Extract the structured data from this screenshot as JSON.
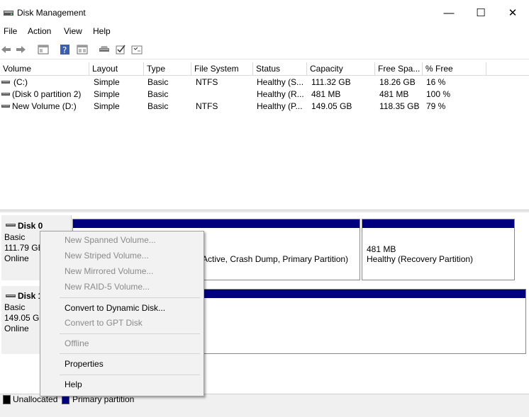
{
  "window": {
    "title": "Disk Management",
    "icon": "disk-management-icon",
    "minimize_glyph": "—",
    "maximize_glyph": "☐",
    "close_glyph": "✕"
  },
  "menu": [
    "File",
    "Action",
    "View",
    "Help"
  ],
  "toolbar": [
    "back-arrow-icon",
    "forward-arrow-icon",
    "console-tree-icon",
    "help-icon",
    "properties-icon",
    "disk-icon",
    "check-icon",
    "list-icon"
  ],
  "columns": [
    "Volume",
    "Layout",
    "Type",
    "File System",
    "Status",
    "Capacity",
    "Free Spa...",
    "% Free"
  ],
  "volumes": [
    [
      "(C:)",
      "Simple",
      "Basic",
      "NTFS",
      "Healthy (S...",
      "111.32 GB",
      "18.26 GB",
      "16 %"
    ],
    [
      "(Disk 0 partition 2)",
      "Simple",
      "Basic",
      "",
      "Healthy (R...",
      "481 MB",
      "481 MB",
      "100 %"
    ],
    [
      "New Volume (D:)",
      "Simple",
      "Basic",
      "NTFS",
      "Healthy (P...",
      "149.05 GB",
      "118.35 GB",
      "79 %"
    ]
  ],
  "disks": [
    {
      "name": "Disk 0",
      "type": "Basic",
      "size": "111.79 GB",
      "status": "Online",
      "partitions": [
        {
          "line1": "",
          "line2": "Active, Crash Dump, Primary Partition)"
        },
        {
          "line1": "481 MB",
          "line2": "Healthy (Recovery Partition)"
        }
      ]
    },
    {
      "name": "Disk 1",
      "type": "Basic",
      "size": "149.05 GB",
      "status": "Online",
      "partitions": []
    }
  ],
  "legend": {
    "unallocated": "Unallocated",
    "primary": "Primary partition",
    "unallocated_color": "#000000",
    "primary_color": "#00007f"
  },
  "context_menu": [
    {
      "label": "New Spanned Volume...",
      "enabled": false
    },
    {
      "label": "New Striped Volume...",
      "enabled": false
    },
    {
      "label": "New Mirrored Volume...",
      "enabled": false
    },
    {
      "label": "New RAID-5 Volume...",
      "enabled": false
    },
    {
      "label": "Convert to Dynamic Disk...",
      "enabled": true
    },
    {
      "label": "Convert to GPT Disk",
      "enabled": false
    },
    {
      "label": "Offline",
      "enabled": false
    },
    {
      "label": "Properties",
      "enabled": true
    },
    {
      "label": "Help",
      "enabled": true
    }
  ]
}
